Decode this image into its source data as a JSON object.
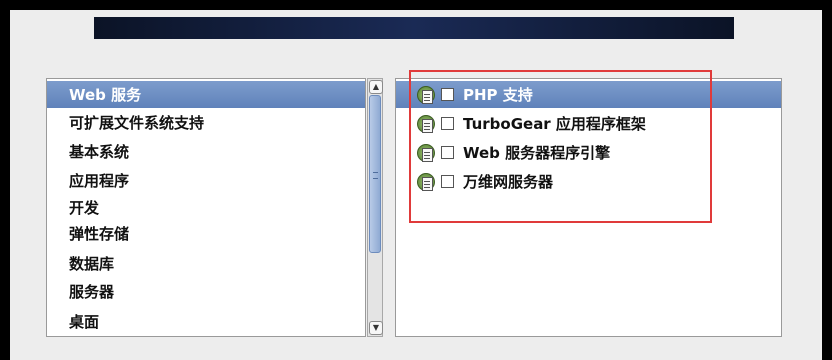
{
  "groups": [
    {
      "label": "Web 服务",
      "selected": true
    },
    {
      "label": "可扩展文件系统支持",
      "selected": false
    },
    {
      "label": "基本系统",
      "selected": false
    },
    {
      "label": "应用程序",
      "selected": false
    },
    {
      "label": "开发",
      "selected": false
    },
    {
      "label": "弹性存储",
      "selected": false
    },
    {
      "label": "数据库",
      "selected": false
    },
    {
      "label": "服务器",
      "selected": false
    },
    {
      "label": "桌面",
      "selected": false
    }
  ],
  "packages": [
    {
      "label": "PHP 支持",
      "checked": false,
      "selected": true
    },
    {
      "label": "TurboGear 应用程序框架",
      "checked": false,
      "selected": false
    },
    {
      "label": "Web 服务器程序引擎",
      "checked": false,
      "selected": false
    },
    {
      "label": "万维网服务器",
      "checked": false,
      "selected": false
    }
  ],
  "icons": {
    "scroll_up": "chevron-up-icon",
    "scroll_down": "chevron-down-icon",
    "package": "package-icon"
  },
  "colors": {
    "selection": "#6b8cc2",
    "annotation_box": "#e03a3a",
    "banner": "#122048"
  }
}
